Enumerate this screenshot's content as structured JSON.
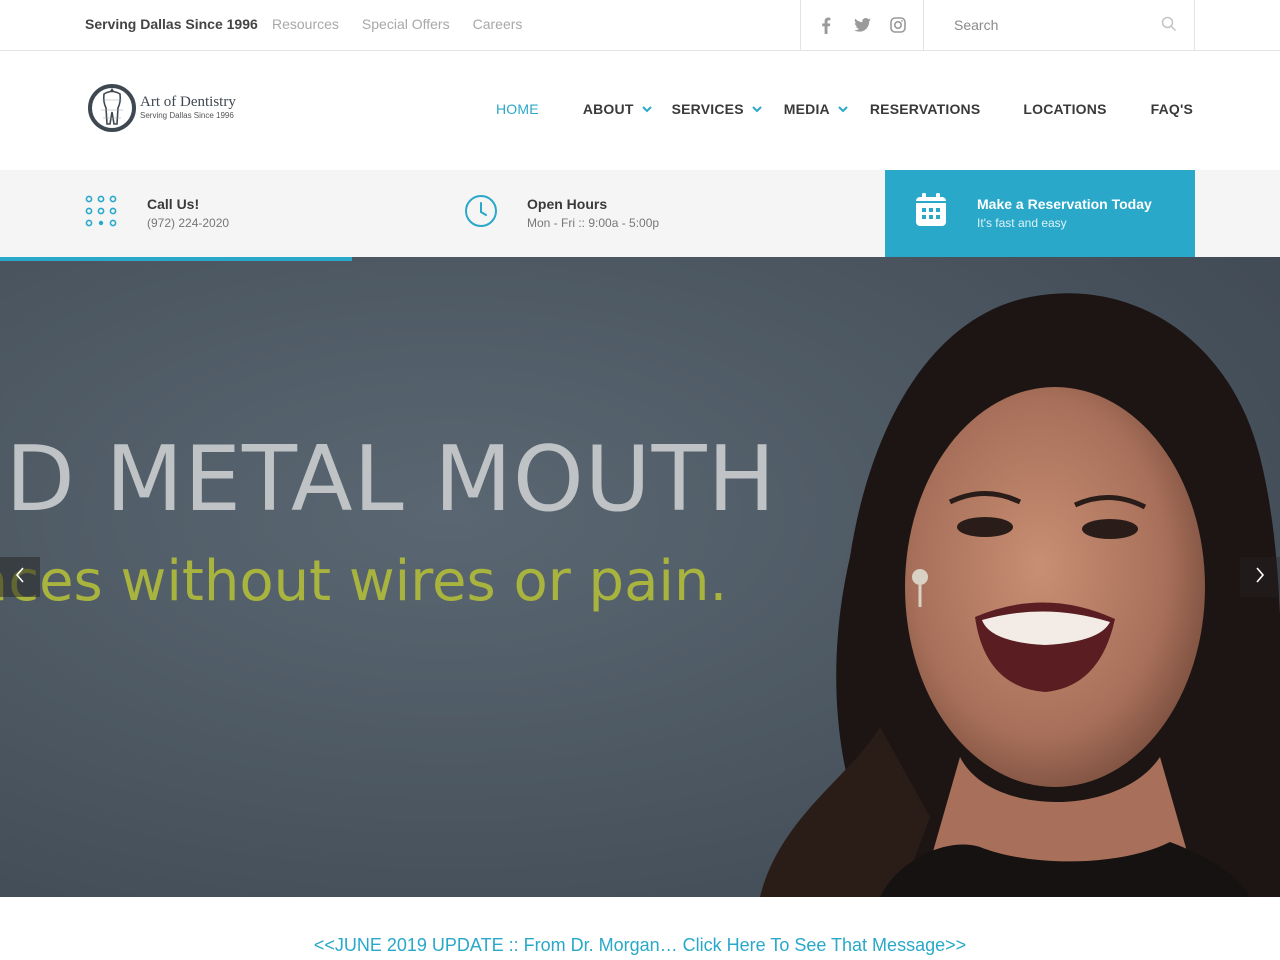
{
  "topbar": {
    "tagline": "Serving Dallas Since 1996",
    "links": [
      "Resources",
      "Special Offers",
      "Careers"
    ],
    "social": [
      "facebook-icon",
      "twitter-icon",
      "instagram-icon"
    ],
    "search_placeholder": "Search"
  },
  "logo": {
    "name": "Art of Dentistry",
    "subtitle": "Serving Dallas Since 1996"
  },
  "nav": {
    "items": [
      {
        "label": "HOME",
        "active": true,
        "dropdown": false
      },
      {
        "label": "ABOUT",
        "active": false,
        "dropdown": true
      },
      {
        "label": "SERVICES",
        "active": false,
        "dropdown": true
      },
      {
        "label": "MEDIA",
        "active": false,
        "dropdown": true
      },
      {
        "label": "RESERVATIONS",
        "active": false,
        "dropdown": false
      },
      {
        "label": "LOCATIONS",
        "active": false,
        "dropdown": false
      },
      {
        "label": "FAQ'S",
        "active": false,
        "dropdown": false
      }
    ]
  },
  "info": {
    "call_title": "Call Us!",
    "call_phone": "(972) 224-2020",
    "hours_title": "Open Hours",
    "hours_value": "Mon - Fri :: 9:00a - 5:00p",
    "reservation_title": "Make a Reservation Today",
    "reservation_sub": "It's fast and easy"
  },
  "slider": {
    "progress_percent": 27.5,
    "headline": "ID METAL MOUTH",
    "subline": "aces without wires or pain."
  },
  "notice": {
    "text": "<<JUNE 2019 UPDATE :: From Dr. Morgan… Click Here To See That Message>>"
  },
  "colors": {
    "accent": "#29a8c9",
    "text_dark": "#3a3a3a",
    "muted": "#a8a8a8",
    "strip_bg": "#f5f5f5",
    "hero_headline": "#bfc3c5",
    "hero_subline": "#a8b43e"
  }
}
